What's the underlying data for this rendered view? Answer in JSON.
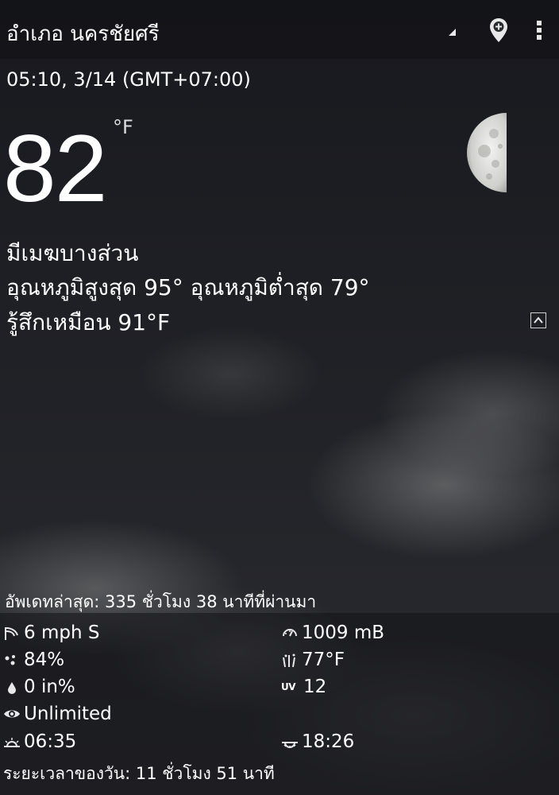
{
  "header": {
    "location": "อำเภอ นครชัยศรี"
  },
  "current": {
    "timestamp": "05:10, 3/14 (GMT+07:00)",
    "temperature": "82",
    "unit": "°F",
    "condition": "มีเมฆบางส่วน",
    "hilo": "อุณหภูมิสูงสุด 95°  อุณหภูมิต่ำสุด 79°",
    "feels_like": "รู้สึกเหมือน 91°F"
  },
  "updated": "อัพเดทล่าสุด: 335 ชั่วโมง 38 นาทีที่ผ่านมา",
  "details": {
    "wind": "6 mph S",
    "pressure": "1009 mB",
    "humidity": "84%",
    "dew_point": "77°F",
    "precipitation": "0 in%",
    "uv_label": "UV",
    "uv_index": "12",
    "visibility": "Unlimited",
    "sunrise": "06:35",
    "sunset": "18:26",
    "day_length": "ระยะเวลาของวัน: 11 ชั่วโมง 51 นาที"
  },
  "icons": {
    "dropdown": "dropdown-triangle-icon",
    "location": "location-pin-icon",
    "menu": "overflow-menu-icon",
    "moon": "half-moon-icon",
    "collapse": "collapse-icon"
  }
}
